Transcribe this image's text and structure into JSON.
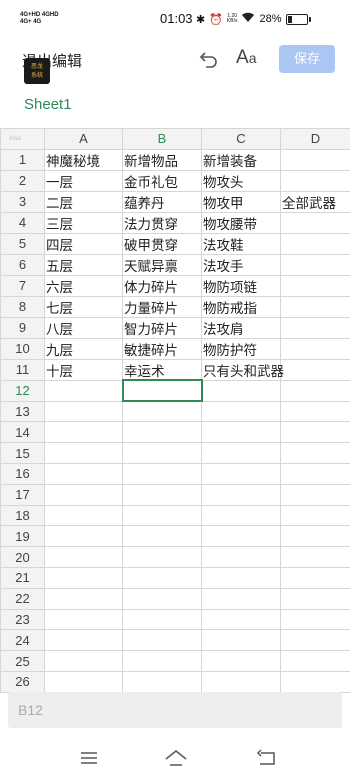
{
  "status_bar": {
    "network_top": "4G+HD",
    "network_bottom": "4G+",
    "network_top2": "4GHD",
    "network_bottom2": "4G",
    "time": "01:03",
    "speed_value": "1.20",
    "speed_unit": "KB/s",
    "battery_text": "28%",
    "battery_level": 0.28
  },
  "toolbar": {
    "exit_label": "退出编辑",
    "logo_text_1": "恶龙",
    "logo_text_2": "系统",
    "undo_icon": "undo-icon",
    "font_icon_big": "A",
    "font_icon_small": "a",
    "save_label": "保存"
  },
  "sheet": {
    "tab_name": "Sheet1",
    "corner_label": "xlsx",
    "columns": [
      "A",
      "B",
      "C",
      "D"
    ],
    "active_column": "B",
    "active_row": 12,
    "rows": [
      [
        "神魔秘境",
        "新增物品",
        "新增装备",
        ""
      ],
      [
        "一层",
        "金币礼包",
        "物攻头",
        ""
      ],
      [
        "二层",
        "蕴养丹",
        "物攻甲",
        "全部武器"
      ],
      [
        "三层",
        "法力贯穿",
        "物攻腰带",
        ""
      ],
      [
        "四层",
        "破甲贯穿",
        "法攻鞋",
        ""
      ],
      [
        "五层",
        "天赋异禀",
        "法攻手",
        ""
      ],
      [
        "六层",
        "体力碎片",
        "物防项链",
        ""
      ],
      [
        "七层",
        "力量碎片",
        "物防戒指",
        ""
      ],
      [
        "八层",
        "智力碎片",
        "法攻肩",
        ""
      ],
      [
        "九层",
        "敏捷碎片",
        "物防护符",
        ""
      ],
      [
        "十层",
        "幸运术",
        "只有头和武器",
        ""
      ],
      [
        "",
        "",
        "",
        ""
      ],
      [
        "",
        "",
        "",
        ""
      ],
      [
        "",
        "",
        "",
        ""
      ],
      [
        "",
        "",
        "",
        ""
      ],
      [
        "",
        "",
        "",
        ""
      ],
      [
        "",
        "",
        "",
        ""
      ],
      [
        "",
        "",
        "",
        ""
      ],
      [
        "",
        "",
        "",
        ""
      ],
      [
        "",
        "",
        "",
        ""
      ],
      [
        "",
        "",
        "",
        ""
      ],
      [
        "",
        "",
        "",
        ""
      ],
      [
        "",
        "",
        "",
        ""
      ],
      [
        "",
        "",
        "",
        ""
      ],
      [
        "",
        "",
        "",
        ""
      ],
      [
        "",
        "",
        "",
        ""
      ]
    ]
  },
  "cell_ref": "B12",
  "colors": {
    "accent_green": "#2e8b57",
    "save_button_bg": "#a9c7f2"
  },
  "nav_bar": {
    "menu_icon": "menu-icon",
    "home_icon": "home-icon",
    "back_icon": "back-icon"
  }
}
